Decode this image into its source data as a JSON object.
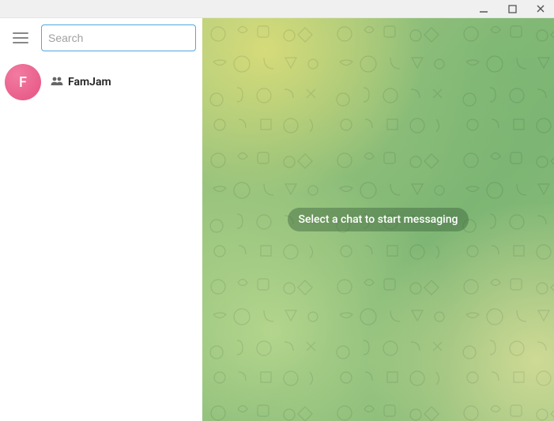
{
  "window": {
    "minimize_icon": "minimize",
    "maximize_icon": "maximize",
    "close_icon": "close"
  },
  "sidebar": {
    "search": {
      "placeholder": "Search",
      "value": ""
    },
    "chats": [
      {
        "avatar_letter": "F",
        "name": "FamJam",
        "is_group": true
      }
    ]
  },
  "main": {
    "empty_hint": "Select a chat to start messaging"
  }
}
